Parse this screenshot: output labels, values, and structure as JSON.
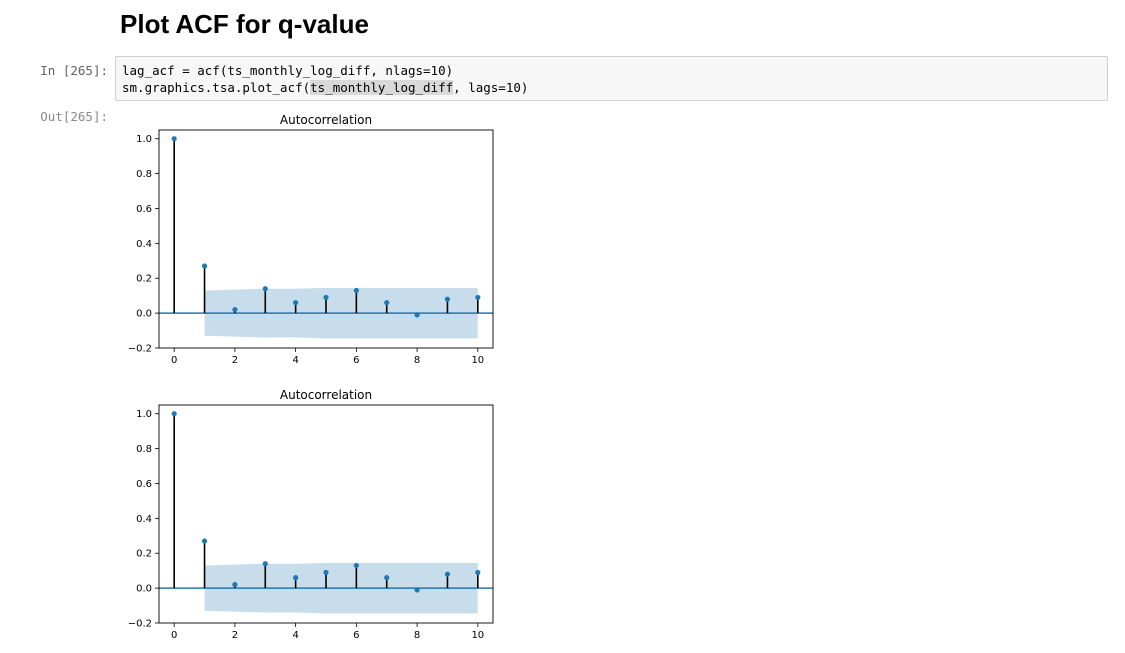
{
  "notebook": {
    "heading": "Plot ACF for q-value",
    "cell": {
      "input_prompt": "In [265]:",
      "output_prompt": "Out[265]:",
      "code_line_1": "lag_acf = acf(ts_monthly_log_diff, nlags=10)",
      "code_line_2_prefix": "sm.graphics.tsa.plot_acf(",
      "code_line_2_highlight": "ts_monthly_log_diff",
      "code_line_2_suffix": ", lags=10)"
    }
  },
  "colors": {
    "stem": "#000000",
    "marker": "#1f77b4",
    "baseline": "#1f77b4",
    "confidence_band": "#1f77b4"
  },
  "chart_data": [
    {
      "type": "scatter",
      "title": "Autocorrelation",
      "xlabel": "",
      "ylabel": "",
      "xlim": [
        -0.5,
        10.5
      ],
      "ylim": [
        -0.2,
        1.05
      ],
      "xticks": [
        0,
        2,
        4,
        6,
        8,
        10
      ],
      "yticks": [
        -0.2,
        0.0,
        0.2,
        0.4,
        0.6,
        0.8,
        1.0
      ],
      "ytick_labels": [
        "−0.2",
        "0.0",
        "0.2",
        "0.4",
        "0.6",
        "0.8",
        "1.0"
      ],
      "grid": false,
      "x": [
        0,
        1,
        2,
        3,
        4,
        5,
        6,
        7,
        8,
        9,
        10
      ],
      "values": [
        1.0,
        0.27,
        0.02,
        0.14,
        0.06,
        0.09,
        0.13,
        0.06,
        -0.01,
        0.08,
        0.09
      ],
      "confint_upper": [
        0.13,
        0.135,
        0.14,
        0.14,
        0.145,
        0.145,
        0.145,
        0.145,
        0.145,
        0.145
      ],
      "confint_x": [
        1,
        2,
        3,
        4,
        5,
        6,
        7,
        8,
        9,
        10
      ]
    },
    {
      "type": "scatter",
      "title": "Autocorrelation",
      "xlabel": "",
      "ylabel": "",
      "xlim": [
        -0.5,
        10.5
      ],
      "ylim": [
        -0.2,
        1.05
      ],
      "xticks": [
        0,
        2,
        4,
        6,
        8,
        10
      ],
      "yticks": [
        -0.2,
        0.0,
        0.2,
        0.4,
        0.6,
        0.8,
        1.0
      ],
      "ytick_labels": [
        "−0.2",
        "0.0",
        "0.2",
        "0.4",
        "0.6",
        "0.8",
        "1.0"
      ],
      "grid": false,
      "x": [
        0,
        1,
        2,
        3,
        4,
        5,
        6,
        7,
        8,
        9,
        10
      ],
      "values": [
        1.0,
        0.27,
        0.02,
        0.14,
        0.06,
        0.09,
        0.13,
        0.06,
        -0.01,
        0.08,
        0.09
      ],
      "confint_upper": [
        0.13,
        0.135,
        0.14,
        0.14,
        0.145,
        0.145,
        0.145,
        0.145,
        0.145,
        0.145
      ],
      "confint_x": [
        1,
        2,
        3,
        4,
        5,
        6,
        7,
        8,
        9,
        10
      ]
    }
  ]
}
